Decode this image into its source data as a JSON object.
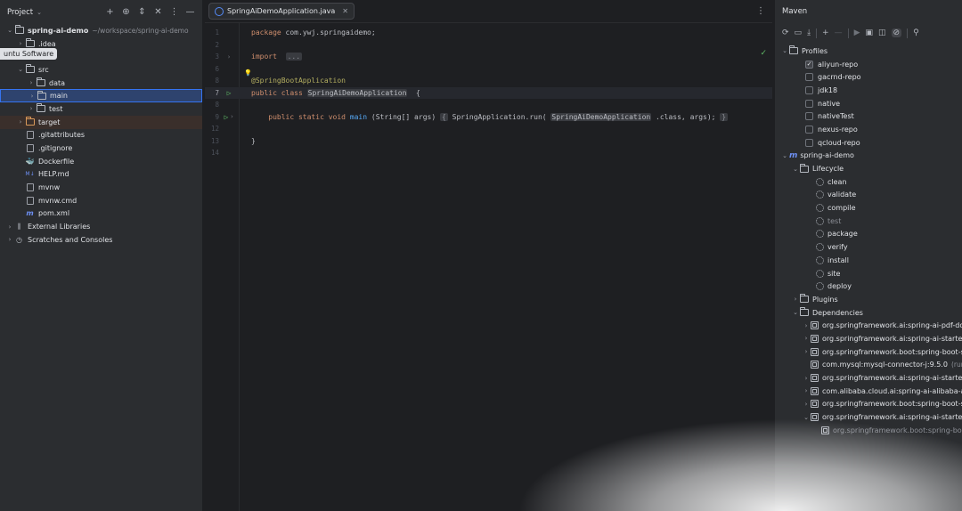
{
  "project": {
    "title": "Project",
    "tooltip": "untu Software",
    "tree": [
      {
        "label": "spring-ai-demo",
        "sub": "~/workspace/spring-ai-demo",
        "indent": 0,
        "arrow": "down",
        "icon": "folder"
      },
      {
        "label": ".idea",
        "indent": 1,
        "arrow": "right",
        "icon": "folder"
      },
      {
        "label": "",
        "indent": 1,
        "arrow": "down",
        "icon": "none"
      },
      {
        "label": "src",
        "indent": 1,
        "arrow": "down",
        "icon": "folder"
      },
      {
        "label": "data",
        "indent": 2,
        "arrow": "right",
        "icon": "folder"
      },
      {
        "label": "main",
        "indent": 2,
        "arrow": "right",
        "icon": "folder",
        "selected": true
      },
      {
        "label": "test",
        "indent": 2,
        "arrow": "right",
        "icon": "folder"
      },
      {
        "label": "target",
        "indent": 1,
        "arrow": "right",
        "icon": "folder-orange",
        "excluded": true
      },
      {
        "label": ".gitattributes",
        "indent": 1,
        "arrow": "",
        "icon": "file"
      },
      {
        "label": ".gitignore",
        "indent": 1,
        "arrow": "",
        "icon": "file"
      },
      {
        "label": "Dockerfile",
        "indent": 1,
        "arrow": "",
        "icon": "docker"
      },
      {
        "label": "HELP.md",
        "indent": 1,
        "arrow": "",
        "icon": "markdown"
      },
      {
        "label": "mvnw",
        "indent": 1,
        "arrow": "",
        "icon": "file"
      },
      {
        "label": "mvnw.cmd",
        "indent": 1,
        "arrow": "",
        "icon": "file"
      },
      {
        "label": "pom.xml",
        "indent": 1,
        "arrow": "",
        "icon": "maven"
      },
      {
        "label": "External Libraries",
        "indent": 0,
        "arrow": "right",
        "icon": "library"
      },
      {
        "label": "Scratches and Consoles",
        "indent": 0,
        "arrow": "right",
        "icon": "scratch"
      }
    ]
  },
  "editor": {
    "tab_label": "SpringAiDemoApplication.java",
    "lines": [
      {
        "n": "1",
        "segs": [
          [
            "kw",
            "package"
          ],
          [
            "",
            "com.ywj.springaidemo;"
          ]
        ]
      },
      {
        "n": "2",
        "segs": []
      },
      {
        "n": "3",
        "segs": [
          [
            "kw",
            "import"
          ],
          [
            "",
            ""
          ],
          [
            "fold",
            "..."
          ]
        ],
        "fold": true
      },
      {
        "n": "6",
        "segs": []
      },
      {
        "n": "8",
        "segs": [
          [
            "ann",
            "@SpringBootApplication"
          ]
        ]
      },
      {
        "n": "7",
        "segs": [
          [
            "kw",
            "public class"
          ],
          [
            "hl",
            "SpringAiDemoApplication"
          ],
          [
            "",
            " {"
          ]
        ],
        "run": true,
        "current": true
      },
      {
        "n": "8",
        "segs": []
      },
      {
        "n": "9",
        "segs": [
          [
            "kw",
            "    public static void"
          ],
          [
            "fn",
            "main"
          ],
          [
            "",
            "(String[] args)"
          ],
          [
            "fold",
            "{"
          ],
          [
            "",
            "SpringApplication.run("
          ],
          [
            "hl",
            "SpringAiDemoApplication"
          ],
          [
            "",
            ".class, args);"
          ],
          [
            "fold",
            "}"
          ]
        ],
        "run": true,
        "fold": true
      },
      {
        "n": "12",
        "segs": []
      },
      {
        "n": "13",
        "segs": [
          [
            "",
            "}"
          ]
        ]
      },
      {
        "n": "14",
        "segs": []
      }
    ]
  },
  "maven": {
    "title": "Maven",
    "profiles_label": "Profiles",
    "profiles": [
      {
        "label": "aliyun-repo",
        "checked": true
      },
      {
        "label": "gacrnd-repo",
        "checked": false
      },
      {
        "label": "jdk18",
        "checked": false
      },
      {
        "label": "native",
        "checked": false
      },
      {
        "label": "nativeTest",
        "checked": false
      },
      {
        "label": "nexus-repo",
        "checked": false
      },
      {
        "label": "qcloud-repo",
        "checked": false
      }
    ],
    "project_label": "spring-ai-demo",
    "lifecycle_label": "Lifecycle",
    "lifecycle": [
      {
        "label": "clean",
        "dim": false
      },
      {
        "label": "validate",
        "dim": false
      },
      {
        "label": "compile",
        "dim": false
      },
      {
        "label": "test",
        "dim": true
      },
      {
        "label": "package",
        "dim": false
      },
      {
        "label": "verify",
        "dim": false
      },
      {
        "label": "install",
        "dim": false
      },
      {
        "label": "site",
        "dim": false
      },
      {
        "label": "deploy",
        "dim": false
      }
    ],
    "plugins_label": "Plugins",
    "dependencies_label": "Dependencies",
    "dependencies": [
      {
        "label": "org.springframework.ai:spring-ai-pdf-do",
        "arrow": "right",
        "indent": 0
      },
      {
        "label": "org.springframework.ai:spring-ai-starter",
        "arrow": "right",
        "indent": 0
      },
      {
        "label": "org.springframework.boot:spring-boot-s",
        "arrow": "right",
        "indent": 0
      },
      {
        "label": "com.mysql:mysql-connector-j:9.5.0",
        "sub": "(run",
        "arrow": "",
        "indent": 0
      },
      {
        "label": "org.springframework.ai:spring-ai-starter",
        "arrow": "right",
        "indent": 0
      },
      {
        "label": "com.alibaba.cloud.ai:spring-ai-alibaba-ag",
        "arrow": "right",
        "indent": 0
      },
      {
        "label": "org.springframework.boot:spring-boot-s",
        "arrow": "right",
        "indent": 0
      },
      {
        "label": "org.springframework.ai:spring-ai-starter",
        "arrow": "down",
        "indent": 0
      },
      {
        "label": "org.springframework.boot:spring-boot",
        "arrow": "",
        "indent": 1,
        "dim": true
      }
    ]
  }
}
